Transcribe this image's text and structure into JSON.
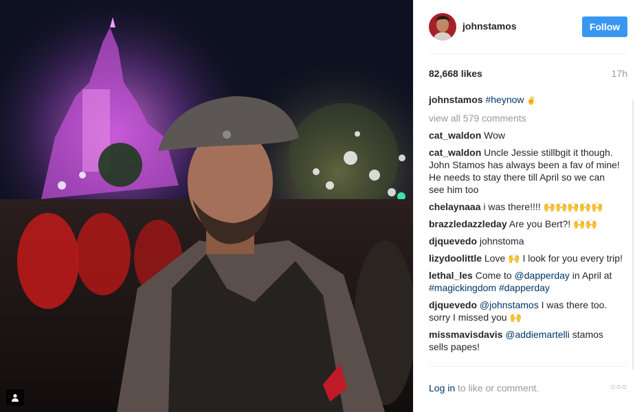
{
  "post": {
    "username": "johnstamos",
    "follow_label": "Follow",
    "likes": "82,668 likes",
    "time": "17h",
    "caption_user": "johnstamos",
    "caption_hashtag": "#heynow",
    "caption_emoji": "✌",
    "view_all": "view all 579 comments"
  },
  "comments": [
    {
      "user": "cat_waldon",
      "text": "Wow"
    },
    {
      "user": "cat_waldon",
      "text": "Uncle Jessie stillbgit it though. John Stamos has always been a fav of mine! He needs to stay there till April so we can see him too"
    },
    {
      "user": "chelaynaaa",
      "text": "i was there!!!! 🙌🙌🙌🙌🙌"
    },
    {
      "user": "brazzledazzleday",
      "text": "Are you Bert?! 🙌🙌"
    },
    {
      "user": "djquevedo",
      "text": "johnstoma"
    },
    {
      "user": "lizydoolittle",
      "text": "Love 🙌 I look for you every trip!"
    },
    {
      "user": "lethal_les",
      "pre": "Come to ",
      "mention": "@dapperday",
      "mid": " in April at ",
      "tag1": "#magickingdom",
      "tag2": "#dapperday"
    },
    {
      "user": "djquevedo",
      "mention": "@johnstamos",
      "post": " I was there too. sorry I missed you 🙌"
    },
    {
      "user": "missmavisdavis",
      "mention": "@addiemartelli",
      "post": " stamos sells papes!"
    }
  ],
  "footer": {
    "login": "Log in",
    "rest": " to like or comment.",
    "more": "○○○"
  }
}
